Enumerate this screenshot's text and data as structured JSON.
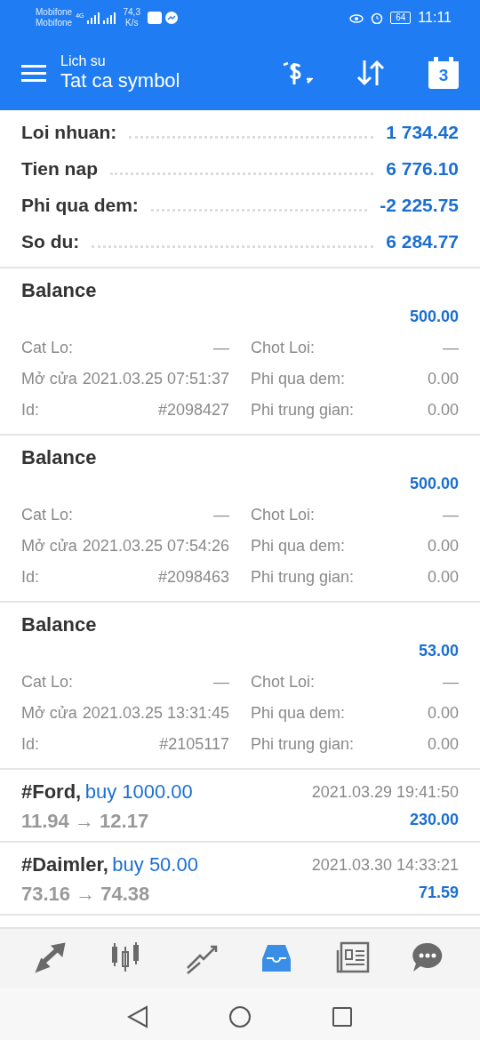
{
  "status_bar": {
    "carriers": [
      "Mobifone",
      "Mobifone"
    ],
    "network_type": "4G",
    "speed_value": "74,3",
    "speed_unit": "K/s",
    "battery": "64",
    "time": "11:11"
  },
  "header": {
    "subtitle": "Lich su",
    "title": "Tat ca symbol",
    "calendar_day": "3"
  },
  "summary": [
    {
      "label": "Loi nhuan:",
      "value": "1 734.42"
    },
    {
      "label": "Tien nap",
      "value": "6 776.10"
    },
    {
      "label": "Phi qua dem:",
      "value": "-2 225.75"
    },
    {
      "label": "So du:",
      "value": "6 284.77"
    }
  ],
  "records": [
    {
      "kind": "balance",
      "title": "Balance",
      "amount": "500.00",
      "fields": [
        [
          "Cat Lo:",
          "—",
          "Chot Loi:",
          "—"
        ],
        [
          "Mở cửa",
          "2021.03.25 07:51:37",
          "Phi qua dem:",
          "0.00"
        ],
        [
          "Id:",
          "#2098427",
          "Phi trung gian:",
          "0.00"
        ]
      ]
    },
    {
      "kind": "balance",
      "title": "Balance",
      "amount": "500.00",
      "fields": [
        [
          "Cat Lo:",
          "—",
          "Chot Loi:",
          "—"
        ],
        [
          "Mở cửa",
          "2021.03.25 07:54:26",
          "Phi qua dem:",
          "0.00"
        ],
        [
          "Id:",
          "#2098463",
          "Phi trung gian:",
          "0.00"
        ]
      ]
    },
    {
      "kind": "balance",
      "title": "Balance",
      "amount": "53.00",
      "fields": [
        [
          "Cat Lo:",
          "—",
          "Chot Loi:",
          "—"
        ],
        [
          "Mở cửa",
          "2021.03.25 13:31:45",
          "Phi qua dem:",
          "0.00"
        ],
        [
          "Id:",
          "#2105117",
          "Phi trung gian:",
          "0.00"
        ]
      ]
    },
    {
      "kind": "deal",
      "symbol": "#Ford,",
      "action": "buy 1000.00",
      "prices": "11.94 → 12.17",
      "time": "2021.03.29 19:41:50",
      "profit": "230.00"
    },
    {
      "kind": "deal",
      "symbol": "#Daimler,",
      "action": "buy 50.00",
      "prices": "73.16 → 74.38",
      "time": "2021.03.30 14:33:21",
      "profit": "71.59"
    }
  ],
  "nav_tabs": [
    {
      "kind": "trade",
      "selected": false
    },
    {
      "kind": "candles",
      "selected": false
    },
    {
      "kind": "chart",
      "selected": false
    },
    {
      "kind": "inbox",
      "selected": true
    },
    {
      "kind": "news",
      "selected": false
    },
    {
      "kind": "chat",
      "selected": false
    }
  ]
}
